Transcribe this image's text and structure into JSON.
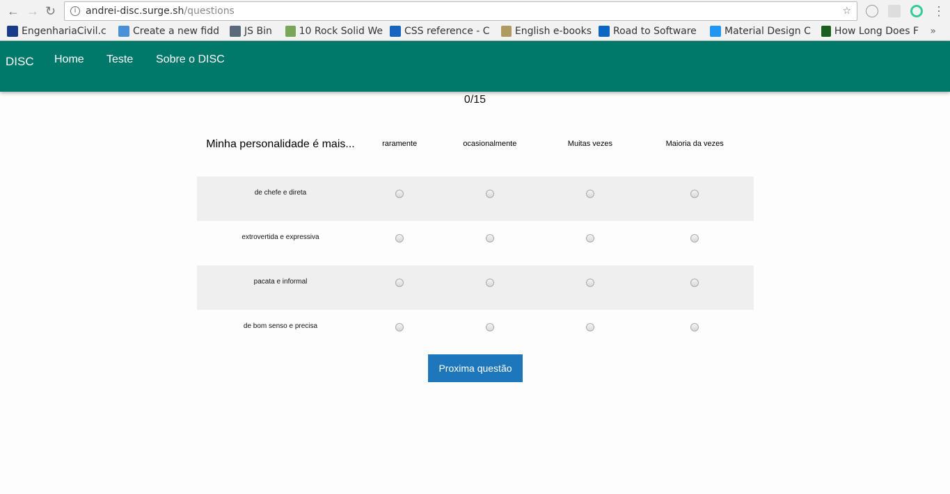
{
  "browser": {
    "url_host": "andrei-disc.surge.sh",
    "url_path": "/questions",
    "bookmarks": [
      {
        "label": "EngenhariaCivil.c",
        "color": "#1a3a8a"
      },
      {
        "label": "Create a new fidd",
        "color": "#4a90d9"
      },
      {
        "label": "JS Bin",
        "color": "#5a6a7a"
      },
      {
        "label": "10 Rock Solid We",
        "color": "#7aa55a"
      },
      {
        "label": "CSS reference - C",
        "color": "#1565c0"
      },
      {
        "label": "English e-books",
        "color": "#b09a60"
      },
      {
        "label": "Road to Software",
        "color": "#0a66c2"
      },
      {
        "label": "Material Design C",
        "color": "#2196f3"
      },
      {
        "label": "How Long Does F",
        "color": "#1b5e20"
      }
    ],
    "more": "»"
  },
  "nav": {
    "brand": "DISC",
    "links": [
      "Home",
      "Teste",
      "Sobre o DISC"
    ]
  },
  "progress": "0/15",
  "question": "Minha personalidade é mais...",
  "columns": [
    "raramente",
    "ocasionalmente",
    "Muitas vezes",
    "Maioria da vezes"
  ],
  "rows": [
    "de chefe e direta",
    "extrovertida e expressiva",
    "pacata e informal",
    "de bom senso e precisa"
  ],
  "next_button": "Proxima questão"
}
